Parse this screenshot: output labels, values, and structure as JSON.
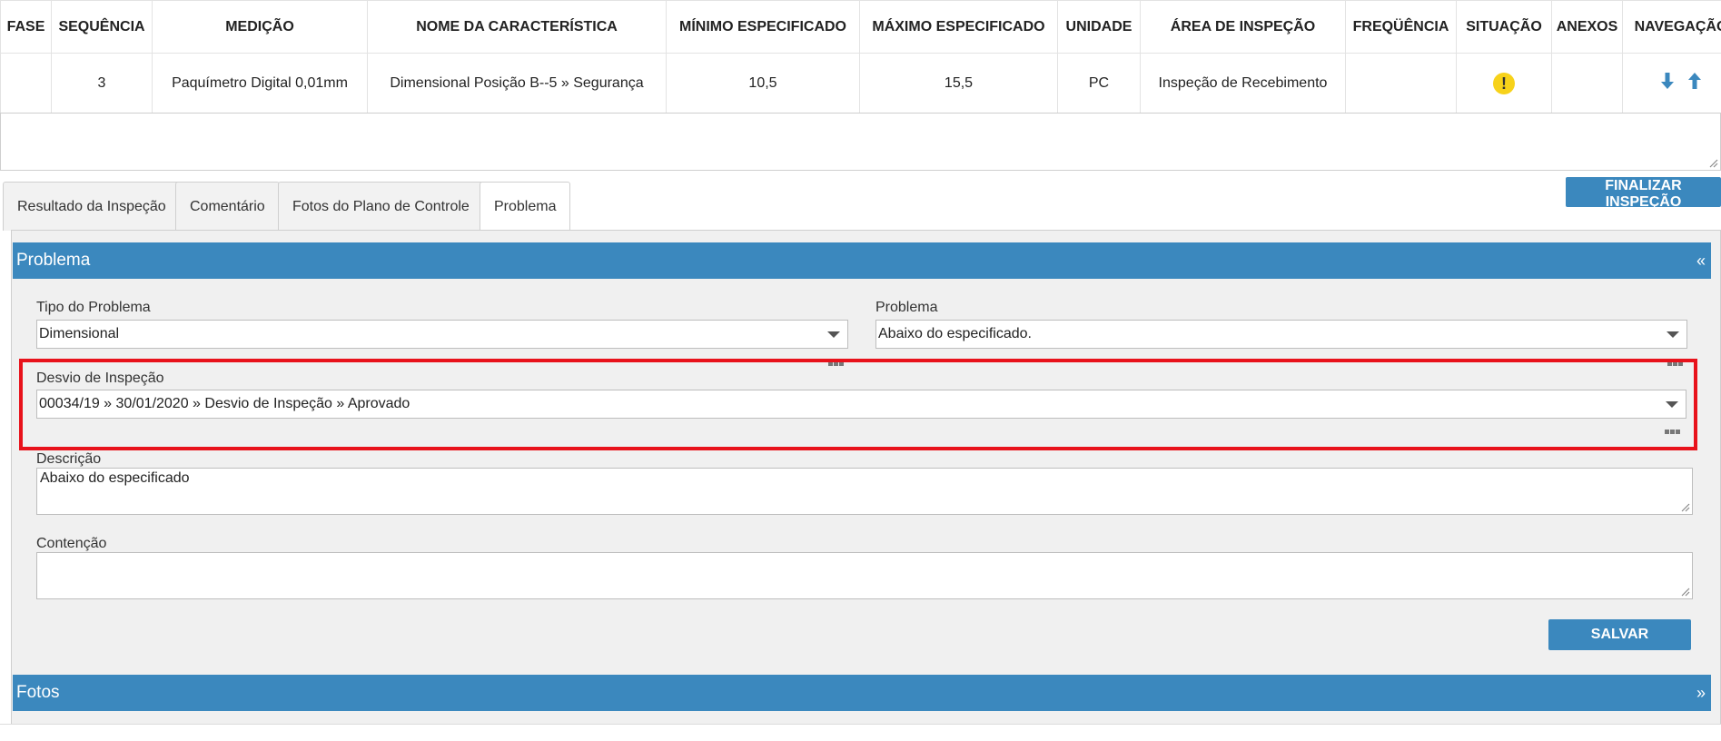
{
  "table": {
    "headers": [
      "FASE",
      "SEQUÊNCIA",
      "MEDIÇÃO",
      "NOME DA CARACTERÍSTICA",
      "MÍNIMO ESPECIFICADO",
      "MÁXIMO ESPECIFICADO",
      "UNIDADE",
      "ÁREA DE INSPEÇÃO",
      "FREQÜÊNCIA",
      "SITUAÇÃO",
      "ANEXOS",
      "NAVEGAÇÃO"
    ],
    "row": {
      "fase": "",
      "sequencia": "3",
      "medicao": "Paquímetro Digital 0,01mm",
      "nome": "Dimensional Posição B--5 » Segurança",
      "minimo": "10,5",
      "maximo": "15,5",
      "unidade": "PC",
      "area": "Inspeção de Recebimento",
      "frequencia": "",
      "situacao_icon": "warning-icon",
      "anexos": "",
      "nav_icons": [
        "arrow-down-icon",
        "arrow-up-icon"
      ]
    }
  },
  "tabs": [
    "Resultado da Inspeção",
    "Comentário",
    "Fotos do Plano de Controle",
    "Problema"
  ],
  "finalize_label": "FINALIZAR INSPEÇÃO",
  "problema_section": {
    "title": "Problema",
    "toggle": "«",
    "tipo_label": "Tipo do Problema",
    "tipo_value": "Dimensional",
    "problema_label": "Problema",
    "problema_value": "Abaixo do especificado.",
    "desvio_label": "Desvio de Inspeção",
    "desvio_value": "00034/19 » 30/01/2020 » Desvio de Inspeção » Aprovado",
    "descricao_label": "Descrição",
    "descricao_value": "Abaixo do especificado",
    "contencao_label": "Contenção",
    "contencao_value": "",
    "save_label": "SALVAR"
  },
  "fotos_section": {
    "title": "Fotos",
    "toggle": "»"
  },
  "colors": {
    "accent": "#3b88be",
    "highlight": "#e8121b",
    "warning": "#f7d21a"
  }
}
